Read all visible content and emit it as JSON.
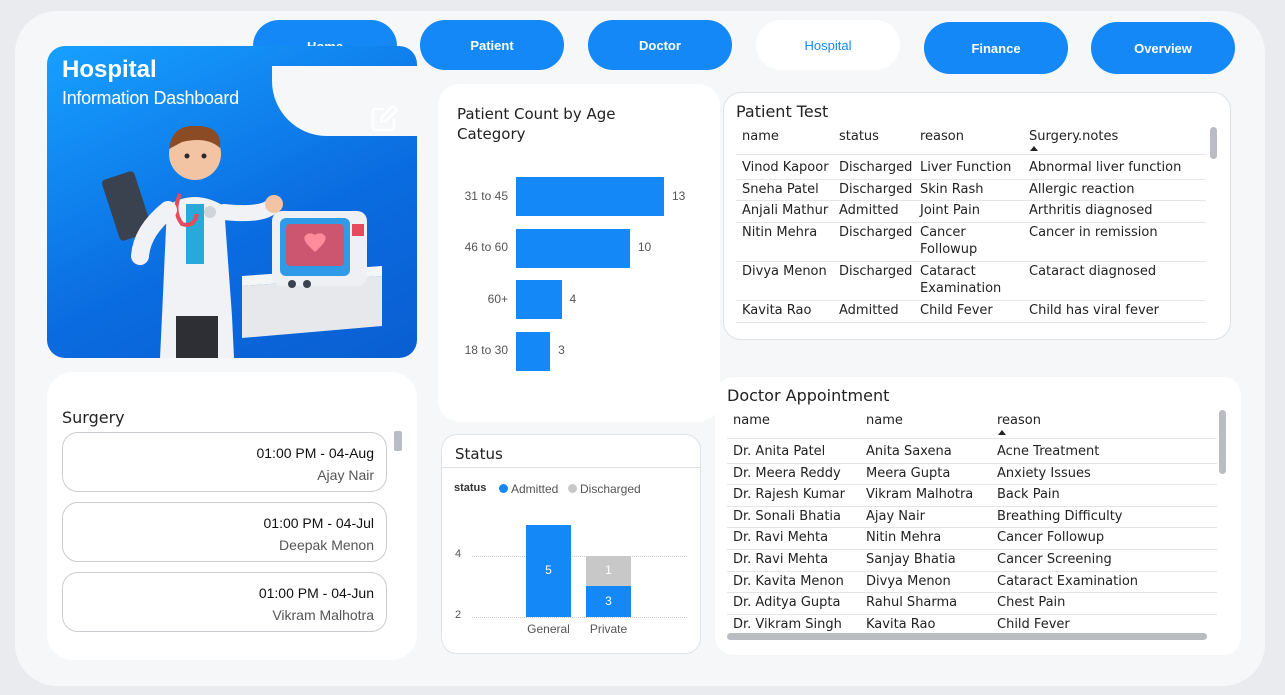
{
  "nav": {
    "items": [
      {
        "label": "Home",
        "active": false
      },
      {
        "label": "Patient",
        "active": false
      },
      {
        "label": "Doctor",
        "active": false
      },
      {
        "label": "Hospital",
        "active": true
      },
      {
        "label": "Finance",
        "active": false
      },
      {
        "label": "Overview",
        "active": false
      }
    ]
  },
  "hero": {
    "title": "Hospital",
    "subtitle": "Information Dashboard",
    "edit_icon": "edit-icon",
    "illustration": "doctor-with-clipboard-and-heart-monitor"
  },
  "surgery": {
    "title": "Surgery",
    "items": [
      {
        "time": "01:00 PM - 04-Aug",
        "name": "Ajay Nair"
      },
      {
        "time": "01:00 PM - 04-Jul",
        "name": "Deepak Menon"
      },
      {
        "time": "01:00 PM - 04-Jun",
        "name": "Vikram Malhotra"
      }
    ]
  },
  "age_chart": {
    "title": "Patient Count by Age Category",
    "chart_data": {
      "type": "bar",
      "orientation": "horizontal",
      "title": "Patient Count by Age Category",
      "categories": [
        "31 to 45",
        "46 to 60",
        "60+",
        "18 to 30"
      ],
      "values": [
        13,
        10,
        4,
        3
      ],
      "color": "#1488f7"
    }
  },
  "status_chart": {
    "title": "Status",
    "legend_title": "status",
    "legend": [
      {
        "label": "Admitted",
        "color": "#1488f7"
      },
      {
        "label": "Discharged",
        "color": "#c8c8c8"
      }
    ],
    "y_ticks": [
      "4",
      "2"
    ],
    "chart_data": {
      "type": "bar",
      "stacked": true,
      "title": "Status",
      "categories": [
        "General",
        "Private"
      ],
      "series": [
        {
          "name": "Admitted",
          "values": [
            5,
            3
          ]
        },
        {
          "name": "Discharged",
          "values": [
            0,
            1
          ]
        }
      ],
      "ylim": [
        2,
        5.6
      ]
    }
  },
  "patient_test": {
    "title": "Patient Test",
    "columns": [
      "name",
      "status",
      "reason",
      "Surgery.notes"
    ],
    "rows": [
      [
        "Vinod Kapoor",
        "Discharged",
        "Liver Function",
        "Abnormal liver function"
      ],
      [
        "Sneha Patel",
        "Discharged",
        "Skin Rash",
        "Allergic reaction"
      ],
      [
        "Anjali Mathur",
        "Admitted",
        "Joint Pain",
        "Arthritis diagnosed"
      ],
      [
        "Nitin Mehra",
        "Discharged",
        "Cancer\nFollowup",
        "Cancer in remission"
      ],
      [
        "Divya Menon",
        "Discharged",
        "Cataract\nExamination",
        "Cataract diagnosed"
      ],
      [
        "Kavita Rao",
        "Admitted",
        "Child Fever",
        "Child has viral fever"
      ]
    ]
  },
  "doctor_appointment": {
    "title": "Doctor Appointment",
    "columns": [
      "name",
      "name",
      "reason"
    ],
    "rows": [
      [
        "Dr. Anita Patel",
        "Anita Saxena",
        "Acne Treatment"
      ],
      [
        "Dr. Meera Reddy",
        "Meera Gupta",
        "Anxiety Issues"
      ],
      [
        "Dr. Rajesh Kumar",
        "Vikram Malhotra",
        "Back Pain"
      ],
      [
        "Dr. Sonali Bhatia",
        "Ajay Nair",
        "Breathing Difficulty"
      ],
      [
        "Dr. Ravi Mehta",
        "Nitin Mehra",
        "Cancer Followup"
      ],
      [
        "Dr. Ravi Mehta",
        "Sanjay Bhatia",
        "Cancer Screening"
      ],
      [
        "Dr. Kavita Menon",
        "Divya Menon",
        "Cataract Examination"
      ],
      [
        "Dr. Aditya Gupta",
        "Rahul Sharma",
        "Chest Pain"
      ],
      [
        "Dr. Vikram Singh",
        "Kavita Rao",
        "Child Fever"
      ]
    ]
  }
}
